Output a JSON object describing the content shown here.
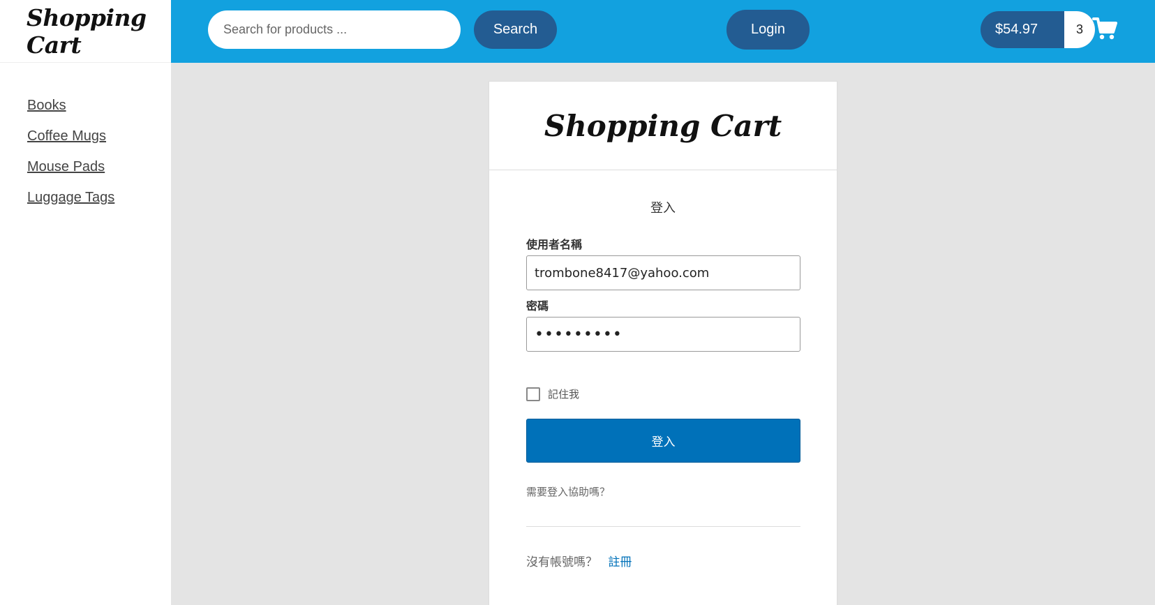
{
  "brand": {
    "name": "Shopping Cart"
  },
  "sidebar": {
    "categories": [
      {
        "label": "Books"
      },
      {
        "label": "Coffee Mugs"
      },
      {
        "label": "Mouse Pads"
      },
      {
        "label": "Luggage Tags"
      }
    ]
  },
  "header": {
    "search_placeholder": "Search for products ...",
    "search_value": "",
    "search_label": "Search",
    "login_label": "Login",
    "cart_total": "$54.97",
    "cart_count": "3",
    "cart_icon": "shopping-cart-icon"
  },
  "login_form": {
    "logo": "Shopping Cart",
    "title": "登入",
    "username_label": "使用者名稱",
    "username_value": "trombone8417@yahoo.com",
    "password_label": "密碼",
    "password_value": "•••••••••",
    "remember_label": "記住我",
    "remember_checked": false,
    "submit_label": "登入",
    "help_link": "需要登入協助嗎？",
    "no_account_text": "沒有帳號嗎？",
    "register_link": "註冊"
  },
  "colors": {
    "header_bg": "#12a1df",
    "pill_bg": "#235c92",
    "primary_button": "#0071b9",
    "page_bg": "#e4e4e4"
  }
}
